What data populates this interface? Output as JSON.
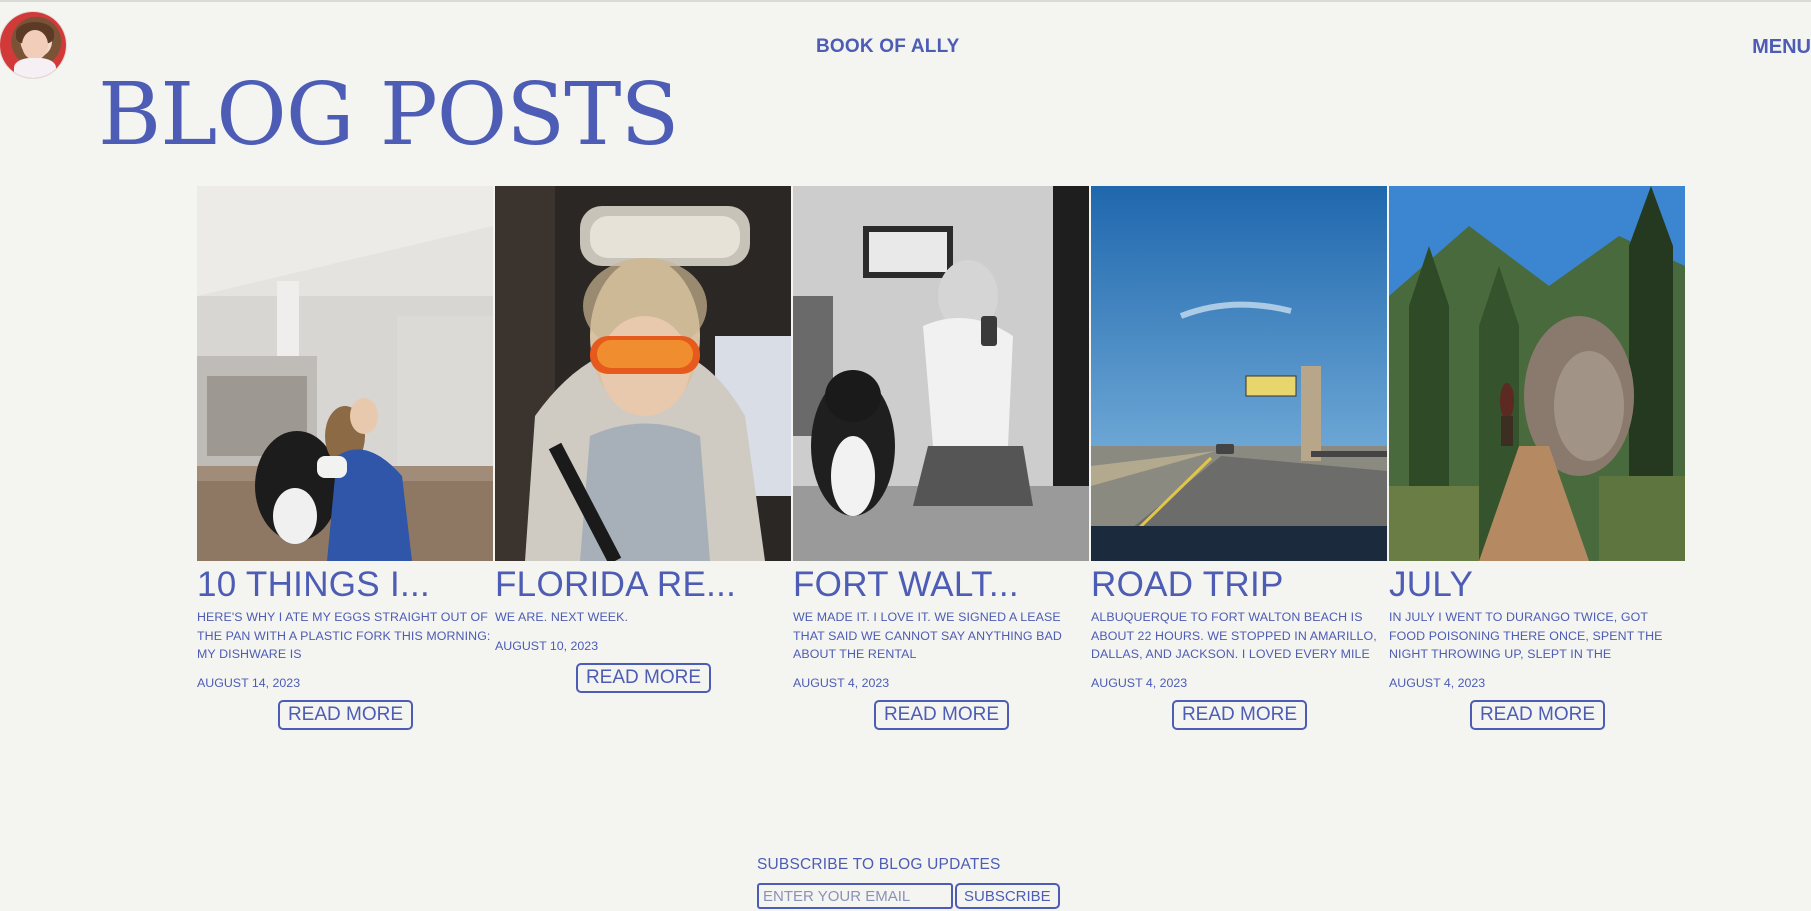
{
  "header": {
    "brand": "BOOK OF ALLY",
    "menu_label": "MENU"
  },
  "page_title": "BLOG POSTS",
  "posts": [
    {
      "title": "10 THINGS I...",
      "excerpt": "HERE'S WHY I ATE MY EGGS STRAIGHT OUT OF THE PAN WITH A PLASTIC FORK THIS MORNING: MY DISHWARE IS",
      "date": "AUGUST 14, 2023",
      "read_more": "READ MORE"
    },
    {
      "title": "FLORIDA RE...",
      "excerpt": "WE ARE. NEXT WEEK.",
      "date": "AUGUST 10, 2023",
      "read_more": "READ MORE"
    },
    {
      "title": "FORT WALT...",
      "excerpt": "WE MADE IT. I LOVE IT. WE SIGNED A LEASE THAT SAID WE CANNOT SAY ANYTHING BAD ABOUT THE RENTAL",
      "date": "AUGUST 4, 2023",
      "read_more": "READ MORE"
    },
    {
      "title": "ROAD TRIP",
      "excerpt": "ALBUQUERQUE TO FORT WALTON BEACH IS ABOUT 22 HOURS. WE STOPPED IN AMARILLO, DALLAS, AND JACKSON. I LOVED EVERY MILE",
      "date": "AUGUST 4, 2023",
      "read_more": "READ MORE"
    },
    {
      "title": "JULY",
      "excerpt": "IN JULY I WENT TO DURANGO TWICE, GOT FOOD POISONING THERE ONCE, SPENT THE NIGHT THROWING UP, SLEPT IN THE",
      "date": "AUGUST 4, 2023",
      "read_more": "READ MORE"
    }
  ],
  "subscribe": {
    "label": "SUBSCRIBE TO BLOG UPDATES",
    "email_placeholder": "ENTER YOUR EMAIL",
    "button_label": "SUBSCRIBE"
  },
  "colors": {
    "accent": "#4d5cb4",
    "background": "#f4f4f1"
  }
}
